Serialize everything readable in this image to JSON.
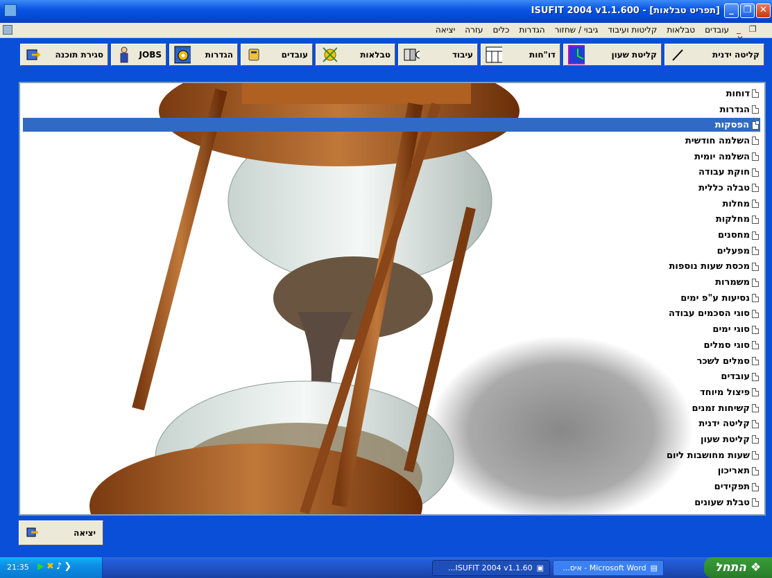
{
  "window": {
    "title": "[תפריט טבלאות] - ISUFIT 2004  v1.1.600"
  },
  "menu": {
    "items": [
      "יציאה",
      "עזרה",
      "כלים",
      "הגדרות",
      "גיבוי / שחזור",
      "קליטות ועיבוד",
      "טבלאות",
      "עובדים"
    ]
  },
  "toolbar": {
    "buttons": [
      {
        "label": "קליטה ידנית",
        "icon": "pen-icon"
      },
      {
        "label": "קליטת שעון",
        "icon": "clock-icon"
      },
      {
        "label": "דו\"חות",
        "icon": "report-icon"
      },
      {
        "label": "עיבוד",
        "icon": "processing-icon"
      },
      {
        "label": "טבלאות",
        "icon": "tables-icon"
      },
      {
        "label": "עובדים",
        "icon": "employees-icon"
      },
      {
        "label": "הגדרות",
        "icon": "settings-icon"
      },
      {
        "label": "JOBS",
        "icon": "jobs-icon"
      },
      {
        "label": "סגירת תוכנה",
        "icon": "exit-icon"
      }
    ]
  },
  "tree": {
    "selected_index": 2,
    "items": [
      "דוחות",
      "הגדרות",
      "הפסקות",
      "השלמה חודשית",
      "השלמה יומית",
      "חוקת עבודה",
      "טבלה כללית",
      "מחלות",
      "מחלקות",
      "מחסנים",
      "מפעלים",
      "מכסת שעות נוספות",
      "משמרות",
      "נסיעות ע\"פ ימים",
      "סוגי הסכמים עבודה",
      "סוגי ימים",
      "סוגי סמלים",
      "סמלים לשכר",
      "עובדים",
      "פיצול מיוחד",
      "קשיחות זמנים",
      "קליטה ידנית",
      "קליטת שעון",
      "שעות מחושבות ליום",
      "תאריכון",
      "תפקידים",
      "טבלת שעונים"
    ]
  },
  "exit_button": {
    "label": "יציאה"
  },
  "taskbar": {
    "start_label": "התחל",
    "tasks": [
      {
        "label": "...ISUFIT 2004  v1.1.60"
      },
      {
        "label": "...איס - Microsoft Word"
      }
    ],
    "clock": "21:35"
  }
}
